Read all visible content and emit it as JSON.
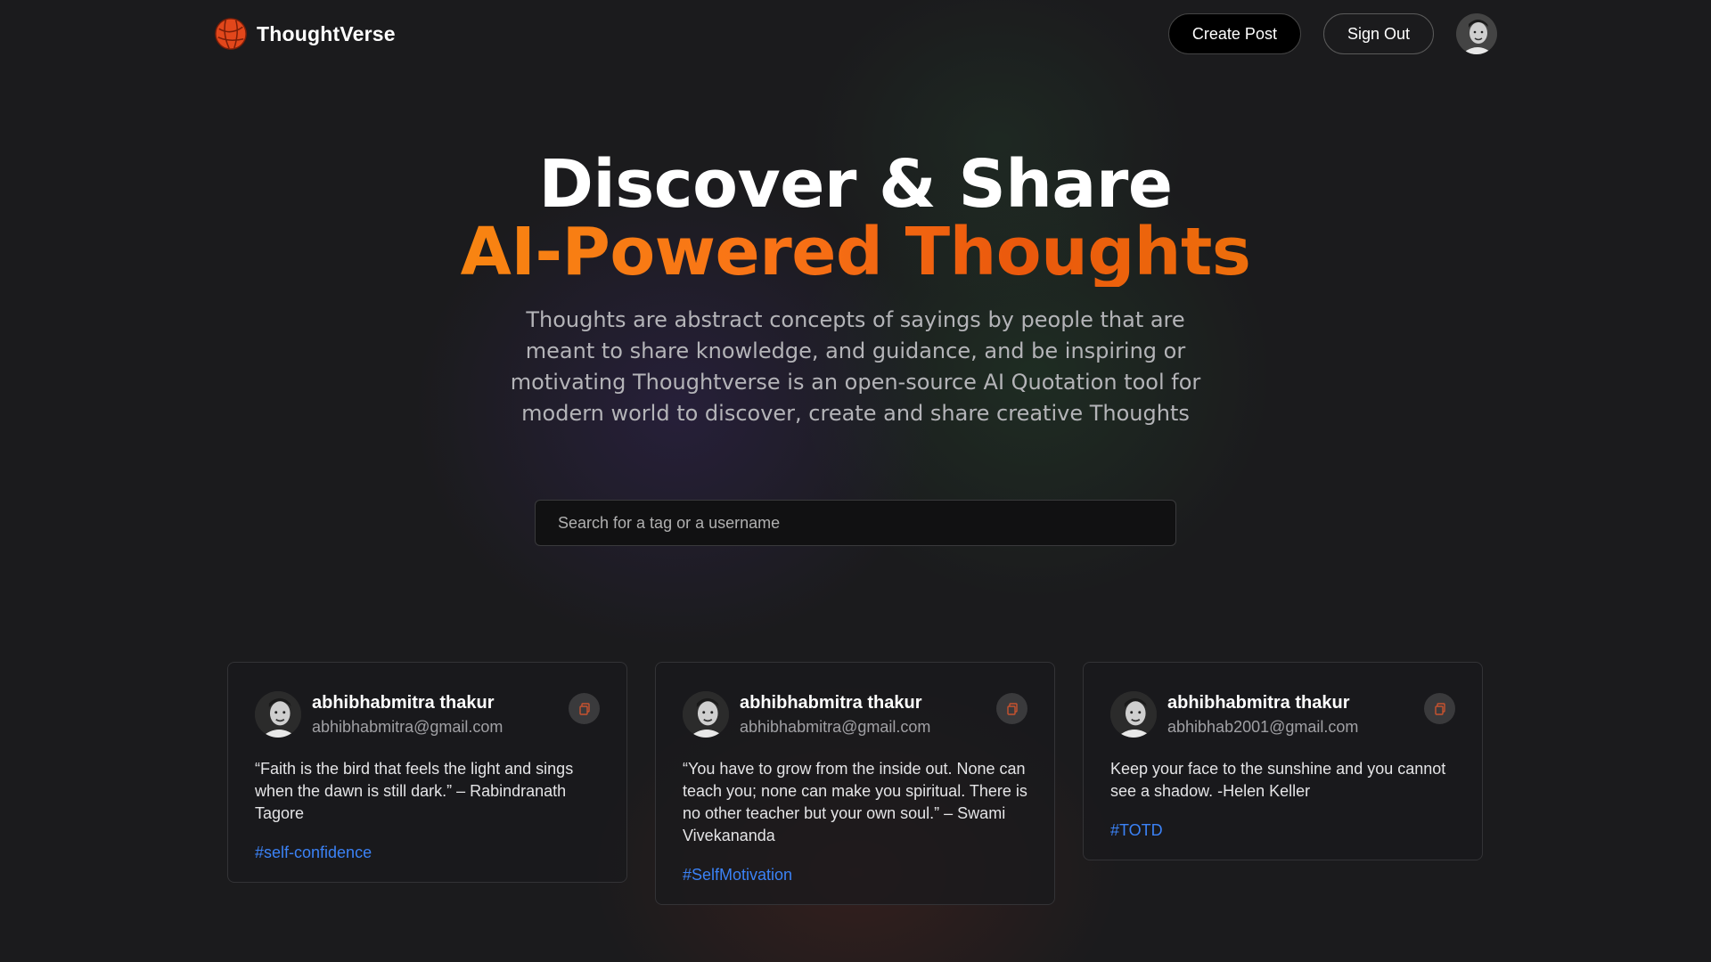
{
  "nav": {
    "brand_name": "ThoughtVerse",
    "create_post_label": "Create Post",
    "sign_out_label": "Sign Out",
    "logo_icon": "globe-logo-icon",
    "brand_color": "#e2471b"
  },
  "hero": {
    "title_line1": "Discover & Share",
    "title_line2": "AI-Powered Thoughts",
    "description": "Thoughts are abstract concepts of sayings by people that are meant to share knowledge, and guidance, and be inspiring or motivating Thoughtverse is an open-source AI Quotation tool for modern world to discover, create and share creative Thoughts",
    "gradient_colors": [
      "#f59e0b",
      "#f97316",
      "#ea580c"
    ]
  },
  "search": {
    "placeholder": "Search for a tag or a username",
    "value": ""
  },
  "posts": [
    {
      "name": "abhibhabmitra thakur",
      "email": "abhibhabmitra@gmail.com",
      "text": "“Faith is the bird that feels the light and sings when the dawn is still dark.” – Rabindranath Tagore",
      "tag": "#self-confidence"
    },
    {
      "name": "abhibhabmitra thakur",
      "email": "abhibhabmitra@gmail.com",
      "text": "“You have to grow from the inside out. None can teach you; none can make you spiritual. There is no other teacher but your own soul.” – Swami Vivekananda",
      "tag": "#SelfMotivation"
    },
    {
      "name": "abhibhabmitra thakur",
      "email": "abhibhab2001@gmail.com",
      "text": "Keep your face to the sunshine and you cannot see a shadow. -Helen Keller",
      "tag": "#TOTD"
    }
  ],
  "colors": {
    "background": "#1b1b1d",
    "tag_link": "#3b82f6",
    "card_border": "#333336"
  }
}
